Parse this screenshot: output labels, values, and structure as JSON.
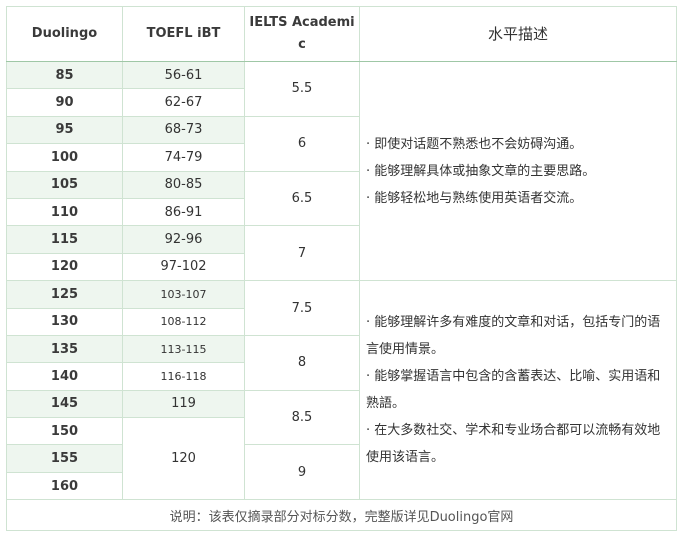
{
  "headers": {
    "duolingo": "Duolingo",
    "toefl": "TOEFL iBT",
    "ielts": "IELTS Academic",
    "desc": "水平描述"
  },
  "rows": [
    {
      "duolingo": "85",
      "toefl": "56-61"
    },
    {
      "duolingo": "90",
      "toefl": "62-67"
    },
    {
      "duolingo": "95",
      "toefl": "68-73"
    },
    {
      "duolingo": "100",
      "toefl": "74-79"
    },
    {
      "duolingo": "105",
      "toefl": "80-85"
    },
    {
      "duolingo": "110",
      "toefl": "86-91"
    },
    {
      "duolingo": "115",
      "toefl": "92-96"
    },
    {
      "duolingo": "120",
      "toefl": "97-102"
    },
    {
      "duolingo": "125",
      "toefl": "103-107"
    },
    {
      "duolingo": "130",
      "toefl": "108-112"
    },
    {
      "duolingo": "135",
      "toefl": "113-115"
    },
    {
      "duolingo": "140",
      "toefl": "116-118"
    },
    {
      "duolingo": "145",
      "toefl": "119"
    },
    {
      "duolingo": "150",
      "toefl": ""
    },
    {
      "duolingo": "155",
      "toefl": "120"
    },
    {
      "duolingo": "160",
      "toefl": ""
    }
  ],
  "ielts": [
    "5.5",
    "6",
    "6.5",
    "7",
    "7.5",
    "8",
    "8.5",
    "9"
  ],
  "descriptions": [
    [
      "· 即使对话题不熟悉也不会妨碍沟通。",
      "· 能够理解具体或抽象文章的主要思路。",
      "· 能够轻松地与熟练使用英语者交流。"
    ],
    [
      "· 能够理解许多有难度的文章和对话，包括专门的语言使用情景。",
      "· 能够掌握语言中包含的含蓄表达、比喻、实用语和熟語。",
      "· 在大多数社交、学术和专业场合都可以流畅有效地使用该语言。"
    ]
  ],
  "note": "说明：该表仅摘录部分对标分数，完整版详见Duolingo官网"
}
